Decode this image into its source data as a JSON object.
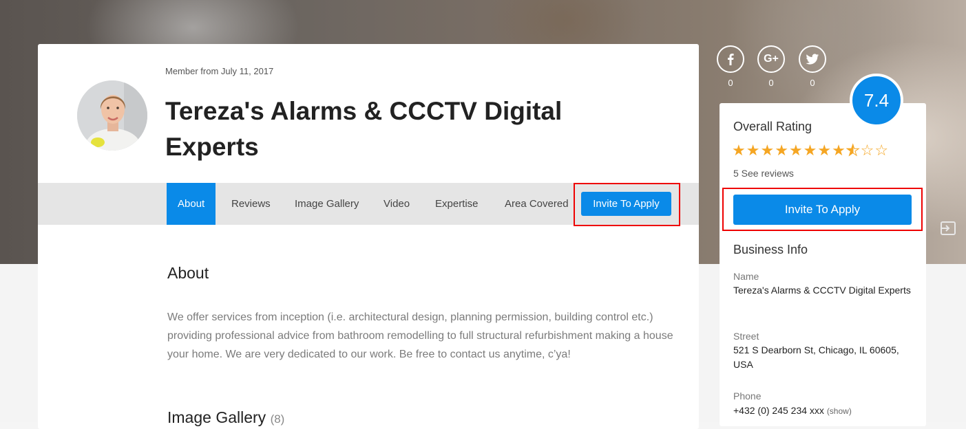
{
  "profile": {
    "member_from": "Member from July 11, 2017",
    "title": "Tereza's Alarms & CCCTV Digital Experts"
  },
  "tabs": [
    {
      "label": "About",
      "active": true
    },
    {
      "label": "Reviews"
    },
    {
      "label": "Image Gallery"
    },
    {
      "label": "Video"
    },
    {
      "label": "Expertise"
    },
    {
      "label": "Area Covered"
    }
  ],
  "tab_invite_label": "Invite To Apply",
  "about": {
    "heading": "About",
    "text": "We offer services from inception (i.e. architectural design, planning permission, building control etc.) providing professional advice from bathroom remodelling to full structural refurbishment making a house your home. We are very dedicated to our work. Be free to contact us anytime, c’ya!"
  },
  "gallery": {
    "heading": "Image Gallery",
    "count": "(8)"
  },
  "social": [
    {
      "icon": "facebook-icon",
      "count": "0"
    },
    {
      "icon": "google-plus-icon",
      "count": "0"
    },
    {
      "icon": "twitter-icon",
      "count": "0"
    }
  ],
  "rating": {
    "score": "7.4",
    "overall_label": "Overall Rating",
    "stars_filled": 8.5,
    "stars_total": 10,
    "see_reviews": "5 See reviews",
    "invite_label": "Invite To Apply"
  },
  "business_info": {
    "heading": "Business Info",
    "name_label": "Name",
    "name_value": "Tereza's Alarms & CCCTV Digital Experts",
    "street_label": "Street",
    "street_value": "521 S Dearborn St, Chicago, IL 60605, USA",
    "phone_label": "Phone",
    "phone_value": "+432 (0) 245 234 xxx",
    "phone_show": "(show)"
  },
  "colors": {
    "accent": "#0a8ae8",
    "star": "#f5a623",
    "highlight": "#ee0000"
  }
}
